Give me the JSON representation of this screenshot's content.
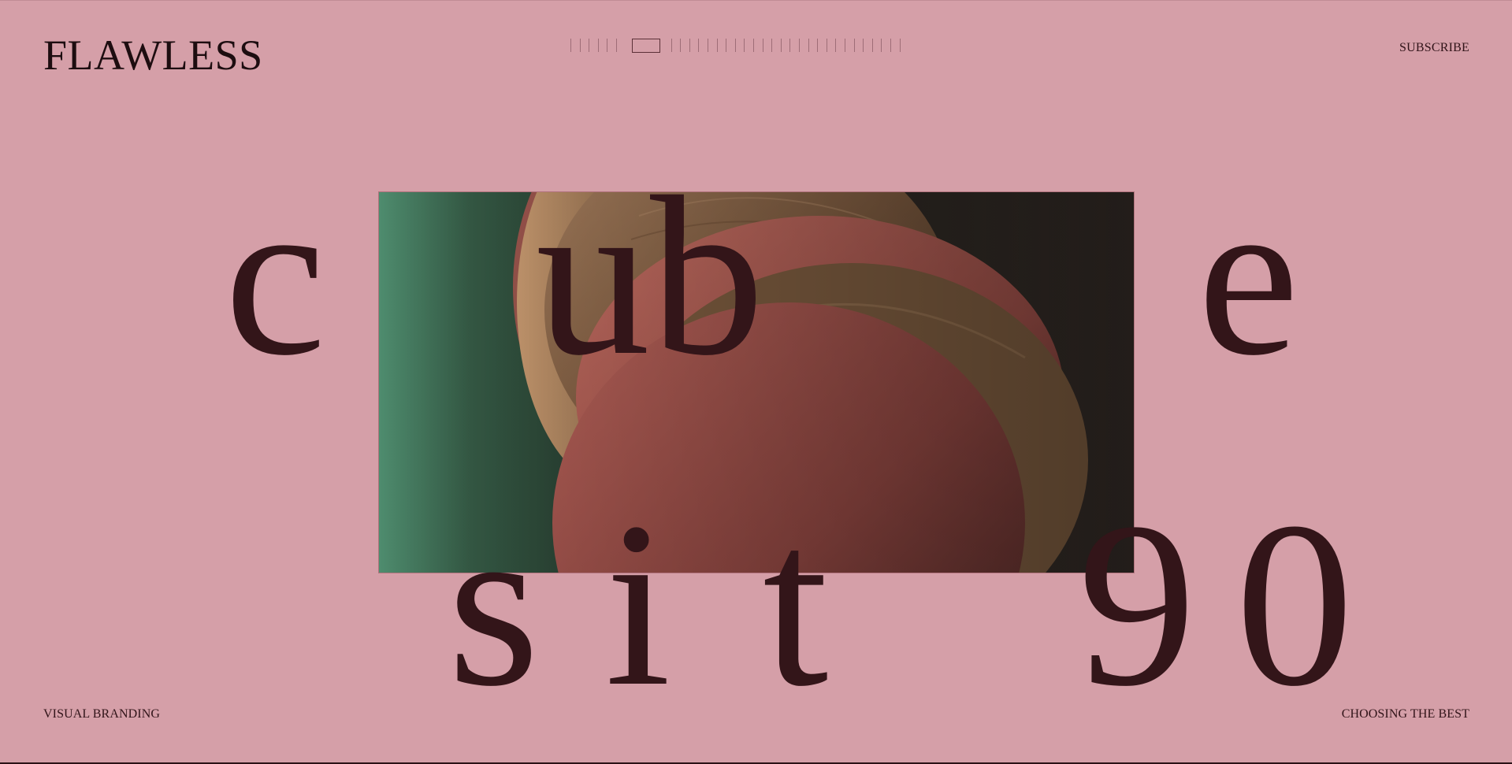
{
  "header": {
    "logo": "FLAWLESS",
    "subscribe_label": "SUBSCRIBE"
  },
  "progress": {
    "total_ticks": 33,
    "active_index": 6
  },
  "headline": {
    "row1": [
      "c",
      "ub",
      "e"
    ],
    "row2": [
      "s",
      "i",
      "t",
      "9",
      "0"
    ]
  },
  "footer": {
    "left_label": "VISUAL BRANDING",
    "right_label": "CHOOSING THE BEST"
  },
  "colors": {
    "background": "#d59fa8",
    "text": "#331519",
    "accent_green": "#4d8a6c",
    "terracotta": "#a9514a",
    "wood": "#8b6546"
  },
  "hero_image": {
    "alt": "abstract terracotta and wooden discs on green background"
  }
}
